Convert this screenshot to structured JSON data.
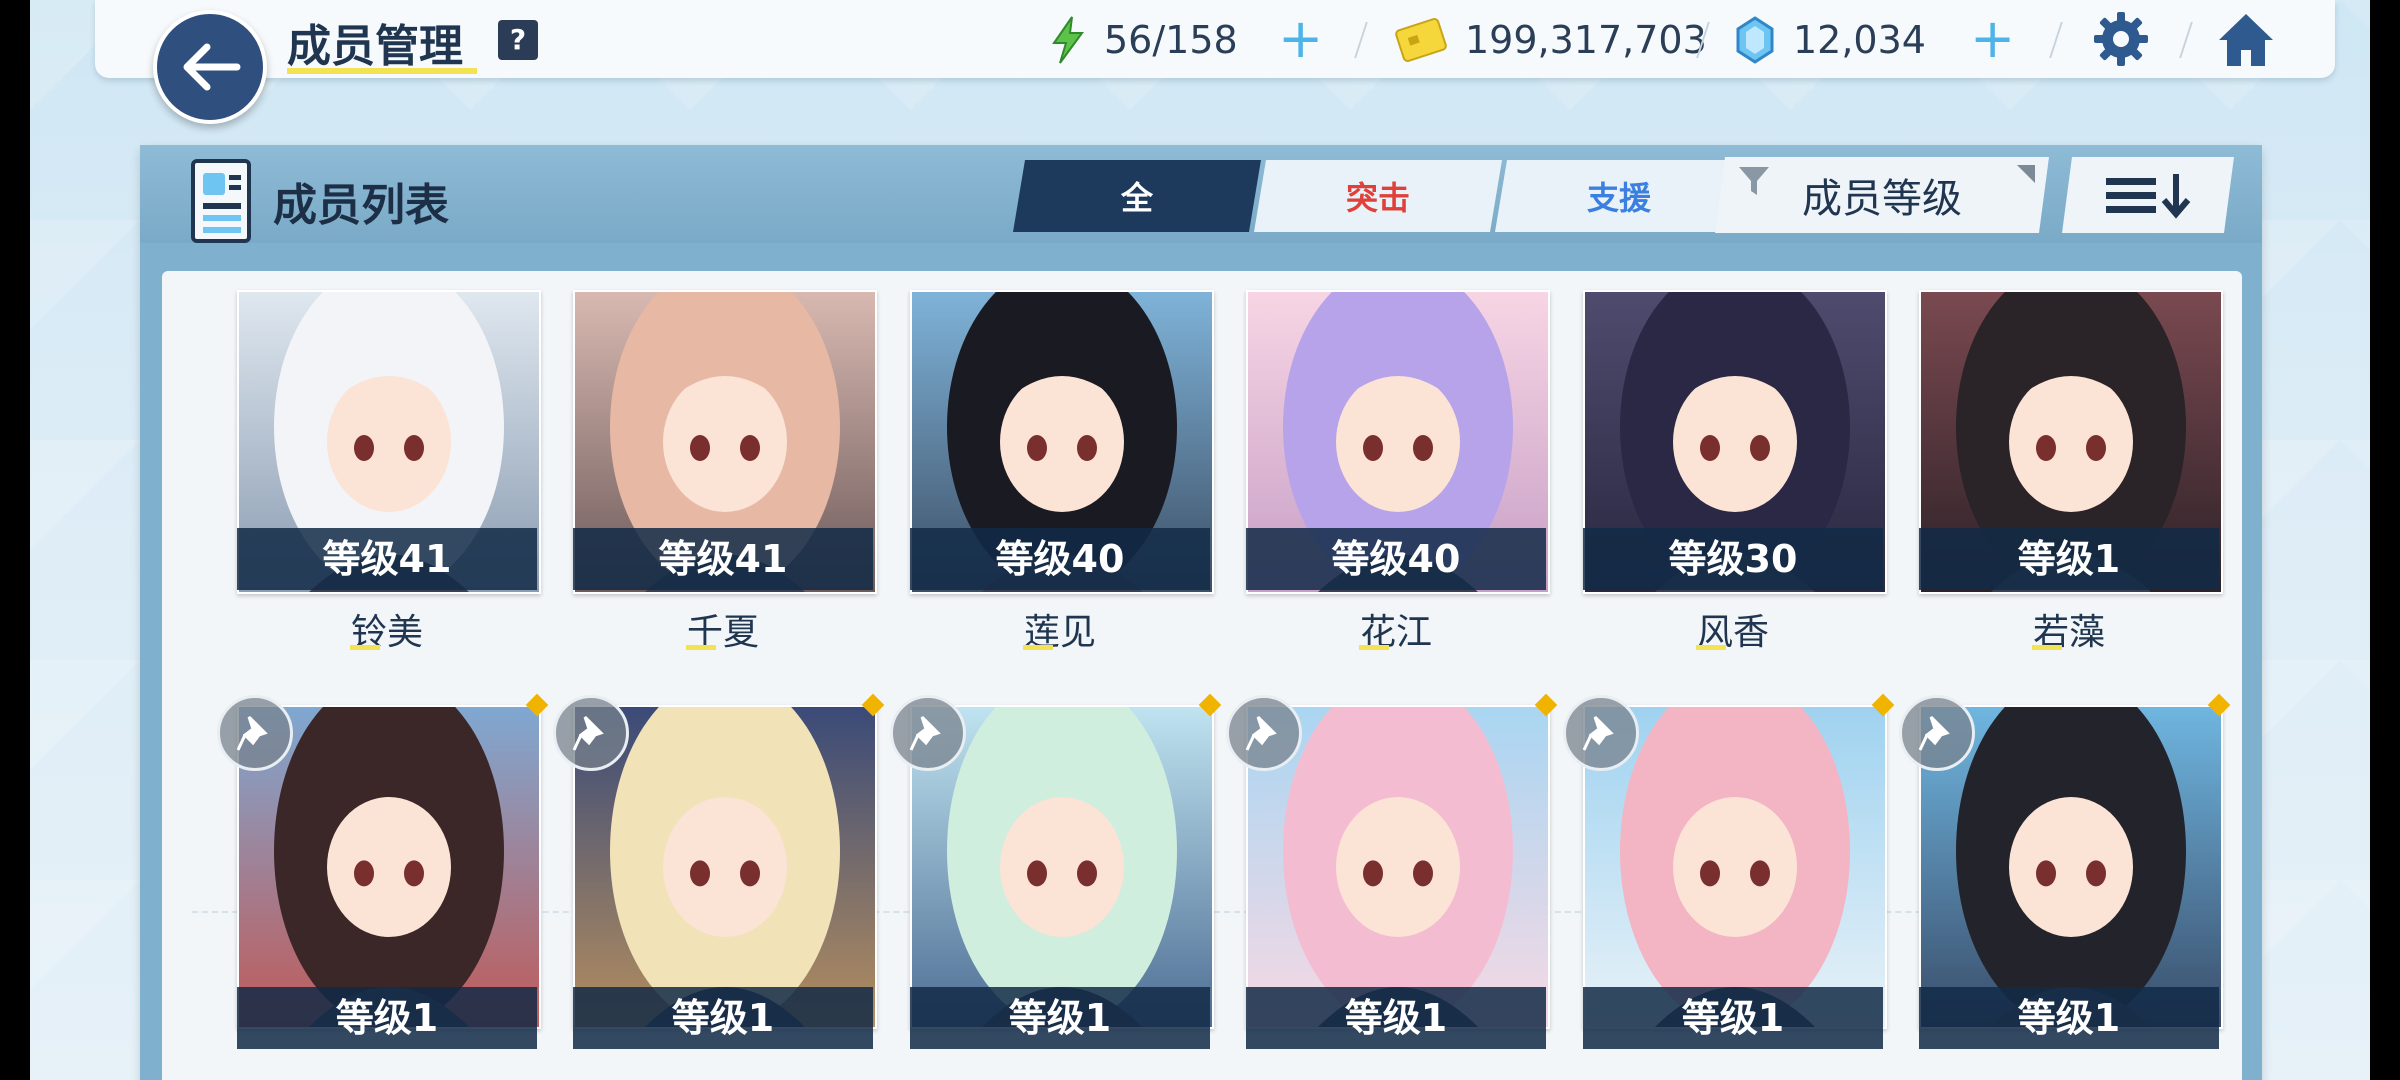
{
  "header": {
    "title": "成员管理",
    "help_label": "?"
  },
  "resources": {
    "ap": "56/158",
    "credits": "199,317,703",
    "gems": "12,034"
  },
  "panel": {
    "title": "成员列表",
    "tabs": [
      {
        "label": "全",
        "color": "#ffffff"
      },
      {
        "label": "突击",
        "color": "#e0403a"
      },
      {
        "label": "支援",
        "color": "#3b7fe0"
      }
    ],
    "sort_label": "成员等级"
  },
  "members_row1": [
    {
      "level": "等级41",
      "name": "铃美",
      "bg": [
        "#dfe7ef",
        "#8a9cb1"
      ],
      "hair": "#f2f4f7"
    },
    {
      "level": "等级41",
      "name": "千夏",
      "bg": [
        "#d8b9b1",
        "#6d5a5a"
      ],
      "hair": "#e7b9a5"
    },
    {
      "level": "等级40",
      "name": "莲见",
      "bg": [
        "#7fb3d9",
        "#3d4f66"
      ],
      "hair": "#1a1a22"
    },
    {
      "level": "等级40",
      "name": "花江",
      "bg": [
        "#f7d5e4",
        "#c79fc6"
      ],
      "hair": "#b6a3ea"
    },
    {
      "level": "等级30",
      "name": "风香",
      "bg": [
        "#4f4b6e",
        "#2a2740"
      ],
      "hair": "#2b2845"
    },
    {
      "level": "等级1",
      "name": "若藻",
      "bg": [
        "#7a4950",
        "#2d2228"
      ],
      "hair": "#2a2327"
    }
  ],
  "members_row2": [
    {
      "level": "等级1",
      "bg": [
        "#7fa8d2",
        "#c05a58"
      ],
      "hair": "#3b2628"
    },
    {
      "level": "等级1",
      "bg": [
        "#3a4a78",
        "#b48e5f"
      ],
      "hair": "#f2e2b8"
    },
    {
      "level": "等级1",
      "bg": [
        "#bfe3f0",
        "#4e6e94"
      ],
      "hair": "#cfeedd"
    },
    {
      "level": "等级1",
      "bg": [
        "#a9d6f2",
        "#f6d8e4"
      ],
      "hair": "#f4bcd0"
    },
    {
      "level": "等级1",
      "bg": [
        "#9fd2f0",
        "#e8f2f8"
      ],
      "hair": "#f3b4c3"
    },
    {
      "level": "等级1",
      "bg": [
        "#6fb6e0",
        "#3a4d6a"
      ],
      "hair": "#23232b"
    }
  ]
}
